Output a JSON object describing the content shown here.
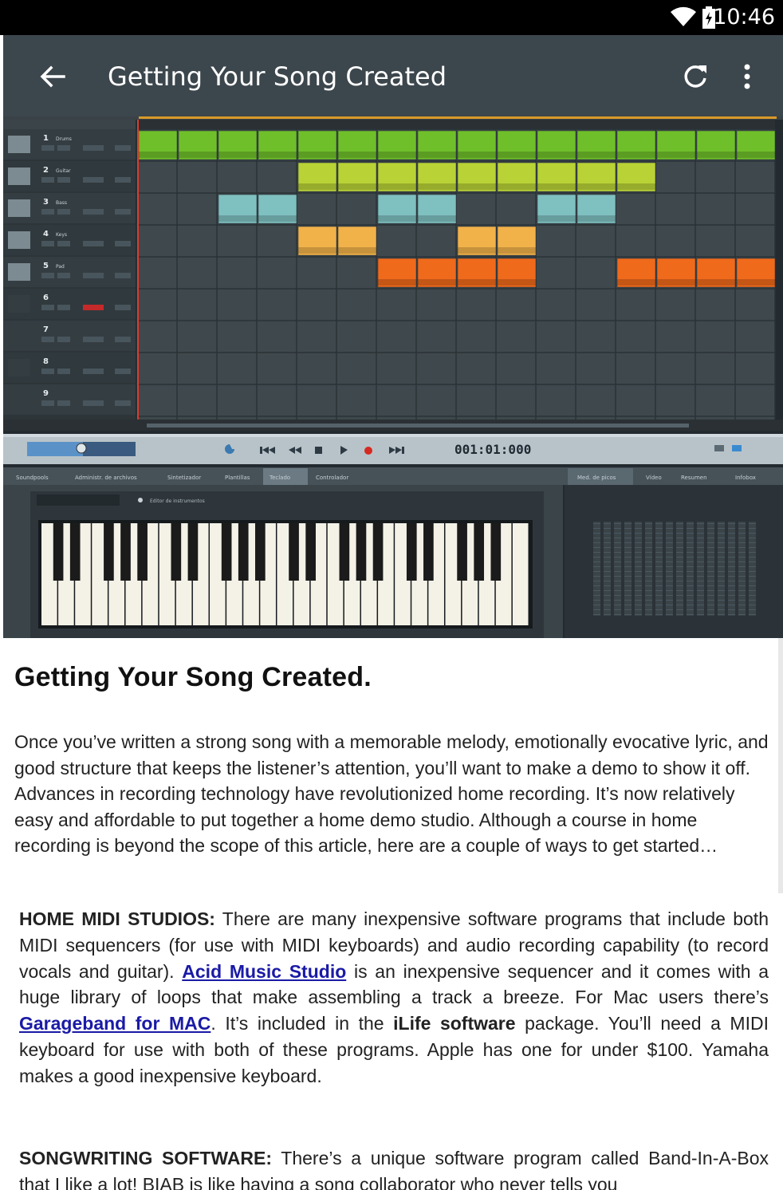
{
  "status_bar": {
    "time": "10:46"
  },
  "app_bar": {
    "title": "Getting Your Song Created"
  },
  "hero": {
    "tracks": [
      {
        "num": "1",
        "name": "Drums"
      },
      {
        "num": "2",
        "name": "Guitar"
      },
      {
        "num": "3",
        "name": "Bass"
      },
      {
        "num": "4",
        "name": "Keys"
      },
      {
        "num": "5",
        "name": "Pad"
      },
      {
        "num": "6",
        "name": ""
      },
      {
        "num": "7",
        "name": ""
      },
      {
        "num": "8",
        "name": ""
      },
      {
        "num": "9",
        "name": ""
      }
    ],
    "transport_time": "001:01:000",
    "tabs_left": [
      "Soundpools",
      "Administr. de archivos",
      "Sintetizador",
      "Plantillas",
      "Teclado",
      "Controlador"
    ],
    "tabs_right": [
      "Med. de picos",
      "Vídeo",
      "Resumen",
      "Infobox"
    ],
    "active_tab_left": "Teclado",
    "keyboard_button": "Editor de instrumentos",
    "colors": {
      "drums": "#6fbf2a",
      "guitar": "#b9d236",
      "bass": "#7fc0c0",
      "keys": "#f2b24a",
      "pad": "#f06a1c"
    }
  },
  "article": {
    "heading": "Getting Your Song Created.",
    "paragraph1": "Once you’ve written a strong song with a memorable melody, emotionally evocative lyric, and good structure that keeps the listener’s attention, you’ll want to make a demo to show it off. Advances in recording technology have revolutionized home recording. It’s now relatively easy and affordable to put together a home demo studio. Although a course in home recording is beyond the scope of this article, here are a couple of ways to get started…",
    "p2_label": "HOME MIDI STUDIOS:",
    "p2_text1": " There are many inexpensive software programs that include both MIDI sequencers (for use with MIDI keyboards) and audio recording capability (to record vocals and guitar). ",
    "p2_link1": "Acid Music Studio",
    "p2_text2": " is an inexpensive sequencer and it comes with a huge library of loops that make assembling a track a breeze. For Mac users there’s ",
    "p2_link2": "Garageband for MAC",
    "p2_text3": ". It’s included in the ",
    "p2_bold": "iLife software",
    "p2_text4": " package. You’ll need a MIDI keyboard for use with both of these programs. Apple has one for under $100. Yamaha makes a good inexpensive keyboard.",
    "p3_label": "SONGWRITING SOFTWARE:",
    "p3_text": " There’s a unique software program called Band-In-A-Box that I like a lot! BIAB is like having a song collaborator who never tells you"
  }
}
